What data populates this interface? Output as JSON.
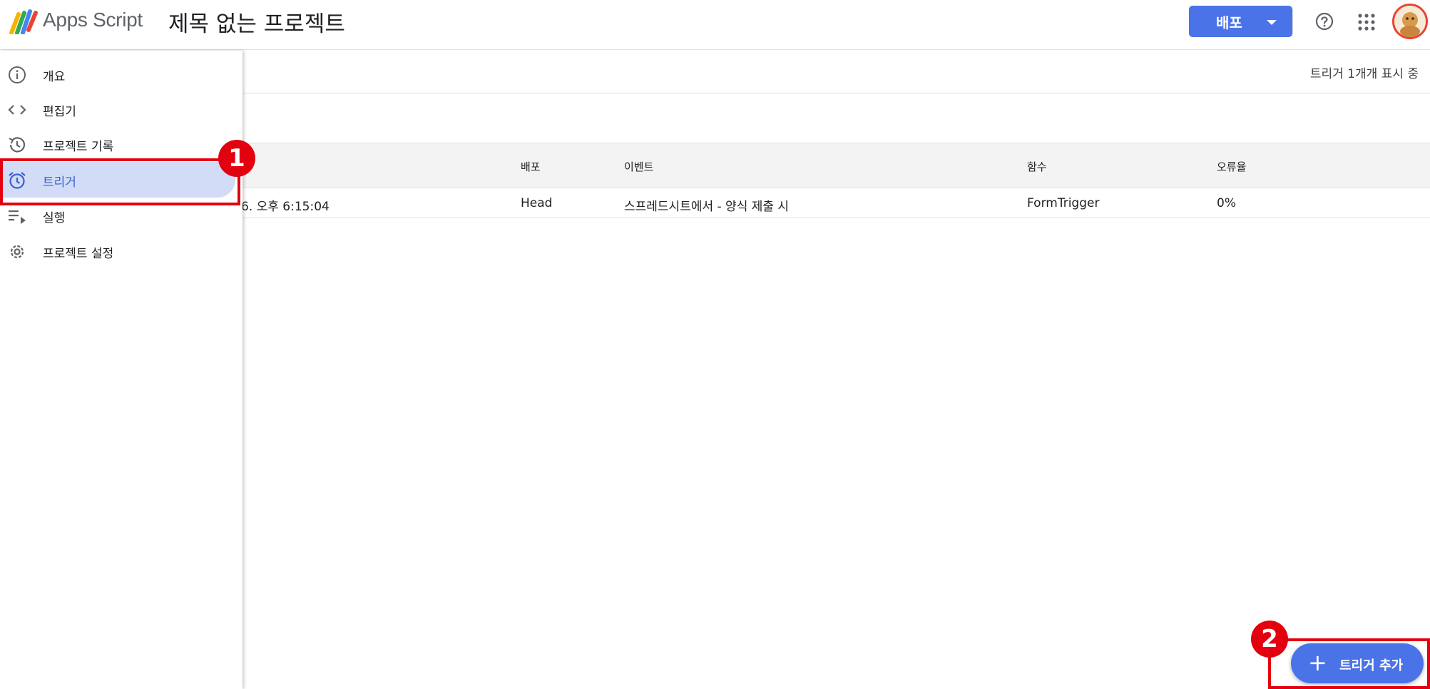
{
  "header": {
    "brand": "Apps Script",
    "project_title": "제목 없는 프로젝트",
    "deploy_label": "배포"
  },
  "sidebar": {
    "items": [
      {
        "label": "개요",
        "icon": "info-icon"
      },
      {
        "label": "편집기",
        "icon": "code-icon"
      },
      {
        "label": "프로젝트 기록",
        "icon": "history-icon"
      },
      {
        "label": "트리거",
        "icon": "alarm-icon",
        "active": true
      },
      {
        "label": "실행",
        "icon": "executions-icon"
      },
      {
        "label": "프로젝트 설정",
        "icon": "gear-icon"
      }
    ]
  },
  "main": {
    "count_text": "트리거 1개개 표시 중",
    "columns": [
      "배포",
      "이벤트",
      "함수",
      "오류율"
    ],
    "rows": [
      {
        "last_run": "6. 오후 6:15:04",
        "deployment": "Head",
        "event": "스프레드시트에서 - 양식 제출 시",
        "function": "FormTrigger",
        "error_rate": "0%"
      }
    ]
  },
  "fab": {
    "label": "트리거 추가",
    "plus": "+"
  },
  "annotations": {
    "badge1": "1",
    "badge2": "2"
  },
  "colors": {
    "accent": "#4a73e8",
    "active_nav_bg": "#d2dcf6",
    "annotation_red": "#e3000f"
  }
}
